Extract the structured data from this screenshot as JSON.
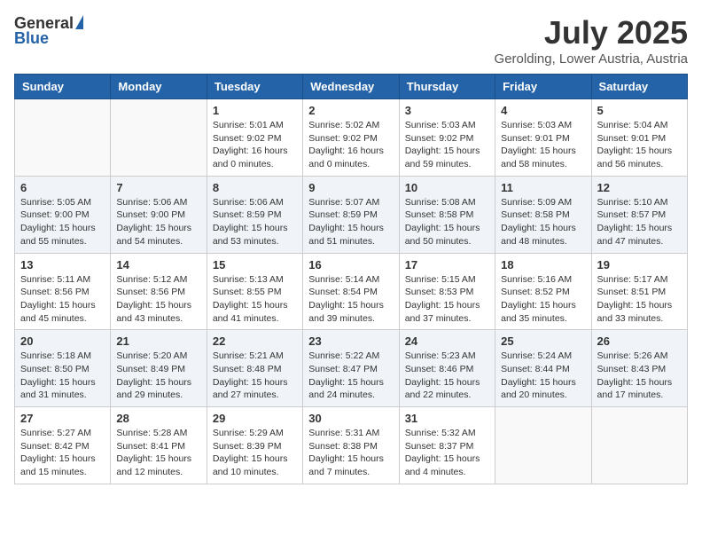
{
  "header": {
    "logo_general": "General",
    "logo_blue": "Blue",
    "month_year": "July 2025",
    "location": "Gerolding, Lower Austria, Austria"
  },
  "days_of_week": [
    "Sunday",
    "Monday",
    "Tuesday",
    "Wednesday",
    "Thursday",
    "Friday",
    "Saturday"
  ],
  "weeks": [
    [
      {
        "day": "",
        "empty": true
      },
      {
        "day": "",
        "empty": true
      },
      {
        "day": "1",
        "sunrise": "Sunrise: 5:01 AM",
        "sunset": "Sunset: 9:02 PM",
        "daylight": "Daylight: 16 hours and 0 minutes."
      },
      {
        "day": "2",
        "sunrise": "Sunrise: 5:02 AM",
        "sunset": "Sunset: 9:02 PM",
        "daylight": "Daylight: 16 hours and 0 minutes."
      },
      {
        "day": "3",
        "sunrise": "Sunrise: 5:03 AM",
        "sunset": "Sunset: 9:02 PM",
        "daylight": "Daylight: 15 hours and 59 minutes."
      },
      {
        "day": "4",
        "sunrise": "Sunrise: 5:03 AM",
        "sunset": "Sunset: 9:01 PM",
        "daylight": "Daylight: 15 hours and 58 minutes."
      },
      {
        "day": "5",
        "sunrise": "Sunrise: 5:04 AM",
        "sunset": "Sunset: 9:01 PM",
        "daylight": "Daylight: 15 hours and 56 minutes."
      }
    ],
    [
      {
        "day": "6",
        "sunrise": "Sunrise: 5:05 AM",
        "sunset": "Sunset: 9:00 PM",
        "daylight": "Daylight: 15 hours and 55 minutes."
      },
      {
        "day": "7",
        "sunrise": "Sunrise: 5:06 AM",
        "sunset": "Sunset: 9:00 PM",
        "daylight": "Daylight: 15 hours and 54 minutes."
      },
      {
        "day": "8",
        "sunrise": "Sunrise: 5:06 AM",
        "sunset": "Sunset: 8:59 PM",
        "daylight": "Daylight: 15 hours and 53 minutes."
      },
      {
        "day": "9",
        "sunrise": "Sunrise: 5:07 AM",
        "sunset": "Sunset: 8:59 PM",
        "daylight": "Daylight: 15 hours and 51 minutes."
      },
      {
        "day": "10",
        "sunrise": "Sunrise: 5:08 AM",
        "sunset": "Sunset: 8:58 PM",
        "daylight": "Daylight: 15 hours and 50 minutes."
      },
      {
        "day": "11",
        "sunrise": "Sunrise: 5:09 AM",
        "sunset": "Sunset: 8:58 PM",
        "daylight": "Daylight: 15 hours and 48 minutes."
      },
      {
        "day": "12",
        "sunrise": "Sunrise: 5:10 AM",
        "sunset": "Sunset: 8:57 PM",
        "daylight": "Daylight: 15 hours and 47 minutes."
      }
    ],
    [
      {
        "day": "13",
        "sunrise": "Sunrise: 5:11 AM",
        "sunset": "Sunset: 8:56 PM",
        "daylight": "Daylight: 15 hours and 45 minutes."
      },
      {
        "day": "14",
        "sunrise": "Sunrise: 5:12 AM",
        "sunset": "Sunset: 8:56 PM",
        "daylight": "Daylight: 15 hours and 43 minutes."
      },
      {
        "day": "15",
        "sunrise": "Sunrise: 5:13 AM",
        "sunset": "Sunset: 8:55 PM",
        "daylight": "Daylight: 15 hours and 41 minutes."
      },
      {
        "day": "16",
        "sunrise": "Sunrise: 5:14 AM",
        "sunset": "Sunset: 8:54 PM",
        "daylight": "Daylight: 15 hours and 39 minutes."
      },
      {
        "day": "17",
        "sunrise": "Sunrise: 5:15 AM",
        "sunset": "Sunset: 8:53 PM",
        "daylight": "Daylight: 15 hours and 37 minutes."
      },
      {
        "day": "18",
        "sunrise": "Sunrise: 5:16 AM",
        "sunset": "Sunset: 8:52 PM",
        "daylight": "Daylight: 15 hours and 35 minutes."
      },
      {
        "day": "19",
        "sunrise": "Sunrise: 5:17 AM",
        "sunset": "Sunset: 8:51 PM",
        "daylight": "Daylight: 15 hours and 33 minutes."
      }
    ],
    [
      {
        "day": "20",
        "sunrise": "Sunrise: 5:18 AM",
        "sunset": "Sunset: 8:50 PM",
        "daylight": "Daylight: 15 hours and 31 minutes."
      },
      {
        "day": "21",
        "sunrise": "Sunrise: 5:20 AM",
        "sunset": "Sunset: 8:49 PM",
        "daylight": "Daylight: 15 hours and 29 minutes."
      },
      {
        "day": "22",
        "sunrise": "Sunrise: 5:21 AM",
        "sunset": "Sunset: 8:48 PM",
        "daylight": "Daylight: 15 hours and 27 minutes."
      },
      {
        "day": "23",
        "sunrise": "Sunrise: 5:22 AM",
        "sunset": "Sunset: 8:47 PM",
        "daylight": "Daylight: 15 hours and 24 minutes."
      },
      {
        "day": "24",
        "sunrise": "Sunrise: 5:23 AM",
        "sunset": "Sunset: 8:46 PM",
        "daylight": "Daylight: 15 hours and 22 minutes."
      },
      {
        "day": "25",
        "sunrise": "Sunrise: 5:24 AM",
        "sunset": "Sunset: 8:44 PM",
        "daylight": "Daylight: 15 hours and 20 minutes."
      },
      {
        "day": "26",
        "sunrise": "Sunrise: 5:26 AM",
        "sunset": "Sunset: 8:43 PM",
        "daylight": "Daylight: 15 hours and 17 minutes."
      }
    ],
    [
      {
        "day": "27",
        "sunrise": "Sunrise: 5:27 AM",
        "sunset": "Sunset: 8:42 PM",
        "daylight": "Daylight: 15 hours and 15 minutes."
      },
      {
        "day": "28",
        "sunrise": "Sunrise: 5:28 AM",
        "sunset": "Sunset: 8:41 PM",
        "daylight": "Daylight: 15 hours and 12 minutes."
      },
      {
        "day": "29",
        "sunrise": "Sunrise: 5:29 AM",
        "sunset": "Sunset: 8:39 PM",
        "daylight": "Daylight: 15 hours and 10 minutes."
      },
      {
        "day": "30",
        "sunrise": "Sunrise: 5:31 AM",
        "sunset": "Sunset: 8:38 PM",
        "daylight": "Daylight: 15 hours and 7 minutes."
      },
      {
        "day": "31",
        "sunrise": "Sunrise: 5:32 AM",
        "sunset": "Sunset: 8:37 PM",
        "daylight": "Daylight: 15 hours and 4 minutes."
      },
      {
        "day": "",
        "empty": true
      },
      {
        "day": "",
        "empty": true
      }
    ]
  ]
}
